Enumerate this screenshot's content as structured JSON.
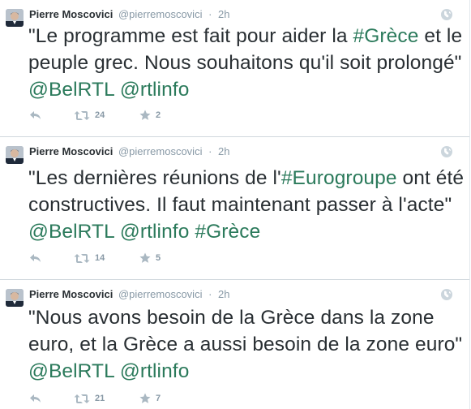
{
  "colors": {
    "hashtag_link": "#2b7a5b",
    "muted": "#8899a6",
    "text": "#292f33"
  },
  "tweets": [
    {
      "author_name": "Pierre Moscovici",
      "author_handle": "@pierremoscovici",
      "separator": "·",
      "time": "2h",
      "segments": [
        {
          "text": "\"Le programme est fait pour aider la ",
          "link": false
        },
        {
          "text": "#Grèce",
          "link": true
        },
        {
          "text": " et le peuple grec. Nous souhaitons qu'il soit prolongé\" ",
          "link": false
        },
        {
          "text": "@BelRTL",
          "link": true
        },
        {
          "text": " ",
          "link": false
        },
        {
          "text": "@rtlinfo",
          "link": true
        }
      ],
      "retweets": "24",
      "favorites": "2",
      "icons": {
        "reply": "reply-icon",
        "retweet": "retweet-icon",
        "favorite": "star-icon",
        "globe": "globe-icon"
      }
    },
    {
      "author_name": "Pierre Moscovici",
      "author_handle": "@pierremoscovici",
      "separator": "·",
      "time": "2h",
      "segments": [
        {
          "text": "\"Les dernières réunions de l'",
          "link": false
        },
        {
          "text": "#Eurogroupe",
          "link": true
        },
        {
          "text": " ont été constructives. Il faut maintenant passer à l'acte\" ",
          "link": false
        },
        {
          "text": "@BelRTL",
          "link": true
        },
        {
          "text": " ",
          "link": false
        },
        {
          "text": "@rtlinfo",
          "link": true
        },
        {
          "text": " ",
          "link": false
        },
        {
          "text": "#Grèce",
          "link": true
        }
      ],
      "retweets": "14",
      "favorites": "5",
      "icons": {
        "reply": "reply-icon",
        "retweet": "retweet-icon",
        "favorite": "star-icon",
        "globe": "globe-icon"
      }
    },
    {
      "author_name": "Pierre Moscovici",
      "author_handle": "@pierremoscovici",
      "separator": "·",
      "time": "2h",
      "segments": [
        {
          "text": "\"Nous avons besoin de la Grèce dans la zone euro, et la Grèce a aussi besoin de la zone euro\" ",
          "link": false
        },
        {
          "text": "@BelRTL",
          "link": true
        },
        {
          "text": " ",
          "link": false
        },
        {
          "text": "@rtlinfo",
          "link": true
        }
      ],
      "retweets": "21",
      "favorites": "7",
      "icons": {
        "reply": "reply-icon",
        "retweet": "retweet-icon",
        "favorite": "star-icon",
        "globe": "globe-icon"
      }
    }
  ]
}
